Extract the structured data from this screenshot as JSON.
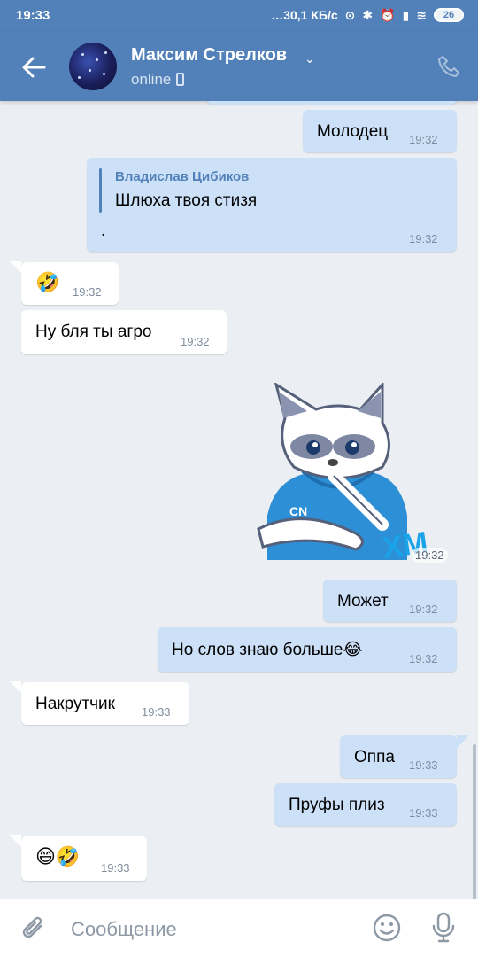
{
  "status_bar": {
    "time": "19:33",
    "network": "…30,1 КБ/с",
    "battery": "26"
  },
  "header": {
    "contact_name": "Максим Стрелков",
    "status": "online"
  },
  "messages": [
    {
      "dir": "out",
      "text": "Молодец",
      "time": "19:32"
    },
    {
      "dir": "out",
      "reply_name": "Владислав Цибиков",
      "reply_text": "Шлюха твоя стизя",
      "text": ".",
      "time": "19:32"
    },
    {
      "dir": "in",
      "text": "🤣",
      "time": "19:32"
    },
    {
      "dir": "in",
      "text": "Ну бля ты агро",
      "time": "19:32"
    },
    {
      "dir": "out",
      "sticker": "fox-sticker",
      "time": "19:32"
    },
    {
      "dir": "out",
      "text": "Может",
      "time": "19:32"
    },
    {
      "dir": "out",
      "text": "Но слов знаю больше😂",
      "time": "19:32"
    },
    {
      "dir": "in",
      "text": "Накрутчик",
      "time": "19:33"
    },
    {
      "dir": "out",
      "text": "Оппа",
      "time": "19:33"
    },
    {
      "dir": "out",
      "text": "Пруфы плиз",
      "time": "19:33"
    },
    {
      "dir": "in",
      "text": "😄🤣",
      "time": "19:33"
    }
  ],
  "sticker_caption": "ХМ",
  "composer": {
    "placeholder": "Сообщение"
  },
  "colors": {
    "header": "#5181b8",
    "outgoing": "#cce0f7",
    "incoming": "#ffffff",
    "background": "#ebeef2"
  }
}
